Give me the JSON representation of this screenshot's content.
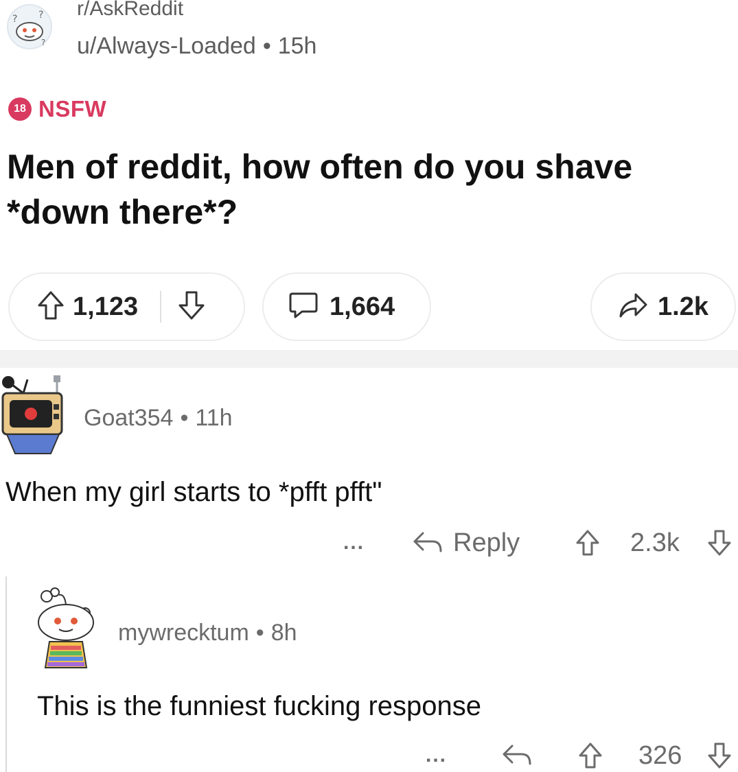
{
  "post": {
    "subreddit": "r/AskReddit",
    "author": "u/Always-Loaded",
    "separator": "•",
    "age": "15h",
    "nsfw_badge": "18",
    "nsfw_label": "NSFW",
    "title": "Men of reddit, how often do you shave *down there*?",
    "upvotes": "1,123",
    "comments": "1,664",
    "shares": "1.2k"
  },
  "comments": [
    {
      "username": "Goat354",
      "separator": "•",
      "age": "11h",
      "body": "When my girl starts to *pfft pfft\"",
      "more": "...",
      "reply_label": "Reply",
      "score": "2.3k"
    },
    {
      "username": "mywrecktum",
      "separator": "•",
      "age": "8h",
      "body": "This is the funniest fucking response",
      "more": "...",
      "score": "326"
    }
  ],
  "icons": {
    "upvote": "arrow-up-icon",
    "downvote": "arrow-down-icon",
    "comment": "speech-bubble-icon",
    "share": "share-arrow-icon",
    "reply": "reply-arrow-icon"
  },
  "colors": {
    "nsfw": "#d93a60",
    "text_muted": "#6b6b6b",
    "pill_border": "#ececec"
  }
}
